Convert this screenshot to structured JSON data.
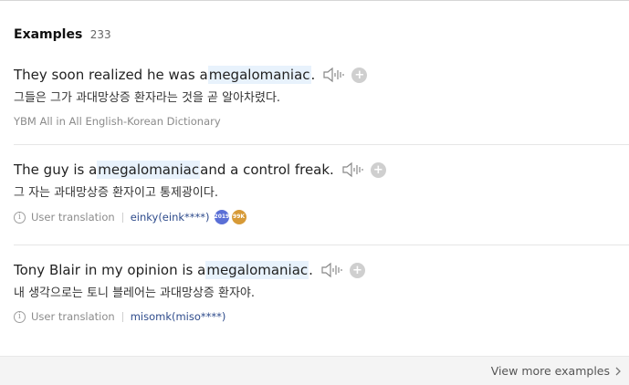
{
  "header": {
    "title": "Examples",
    "count": "233"
  },
  "examples": [
    {
      "pre": "They soon realized he was a ",
      "keyword": "megalomaniac",
      "post": ".",
      "translation": "그들은 그가 과대망상증 환자라는 것을 곧 알아차렸다.",
      "source": "YBM All in All English-Korean Dictionary"
    },
    {
      "pre": "The guy is a ",
      "keyword": "megalomaniac",
      "post": " and a control freak.",
      "translation": "그 자는 과대망상증 환자이고 통제광이다.",
      "source_label": "User translation",
      "user": "einky(eink****)",
      "badge1": "2019",
      "badge2": "99K"
    },
    {
      "pre": "Tony Blair in my opinion is a ",
      "keyword": "megalomaniac",
      "post": ".",
      "translation": "내 생각으로는 토니 블레어는 과대망상증 환자야.",
      "source_label": "User translation",
      "user": "misomk(miso****)"
    }
  ],
  "footer": {
    "more_label": "View more examples"
  },
  "icons": {
    "speaker": "speaker-icon",
    "add": "plus-icon",
    "info": "info-icon",
    "chevron": "chevron-right-icon"
  },
  "colors": {
    "highlight": "#e8f2fc",
    "user_link": "#2f4c8c",
    "badge_blue": "#5a6fd6",
    "badge_gold": "#d79a37"
  }
}
